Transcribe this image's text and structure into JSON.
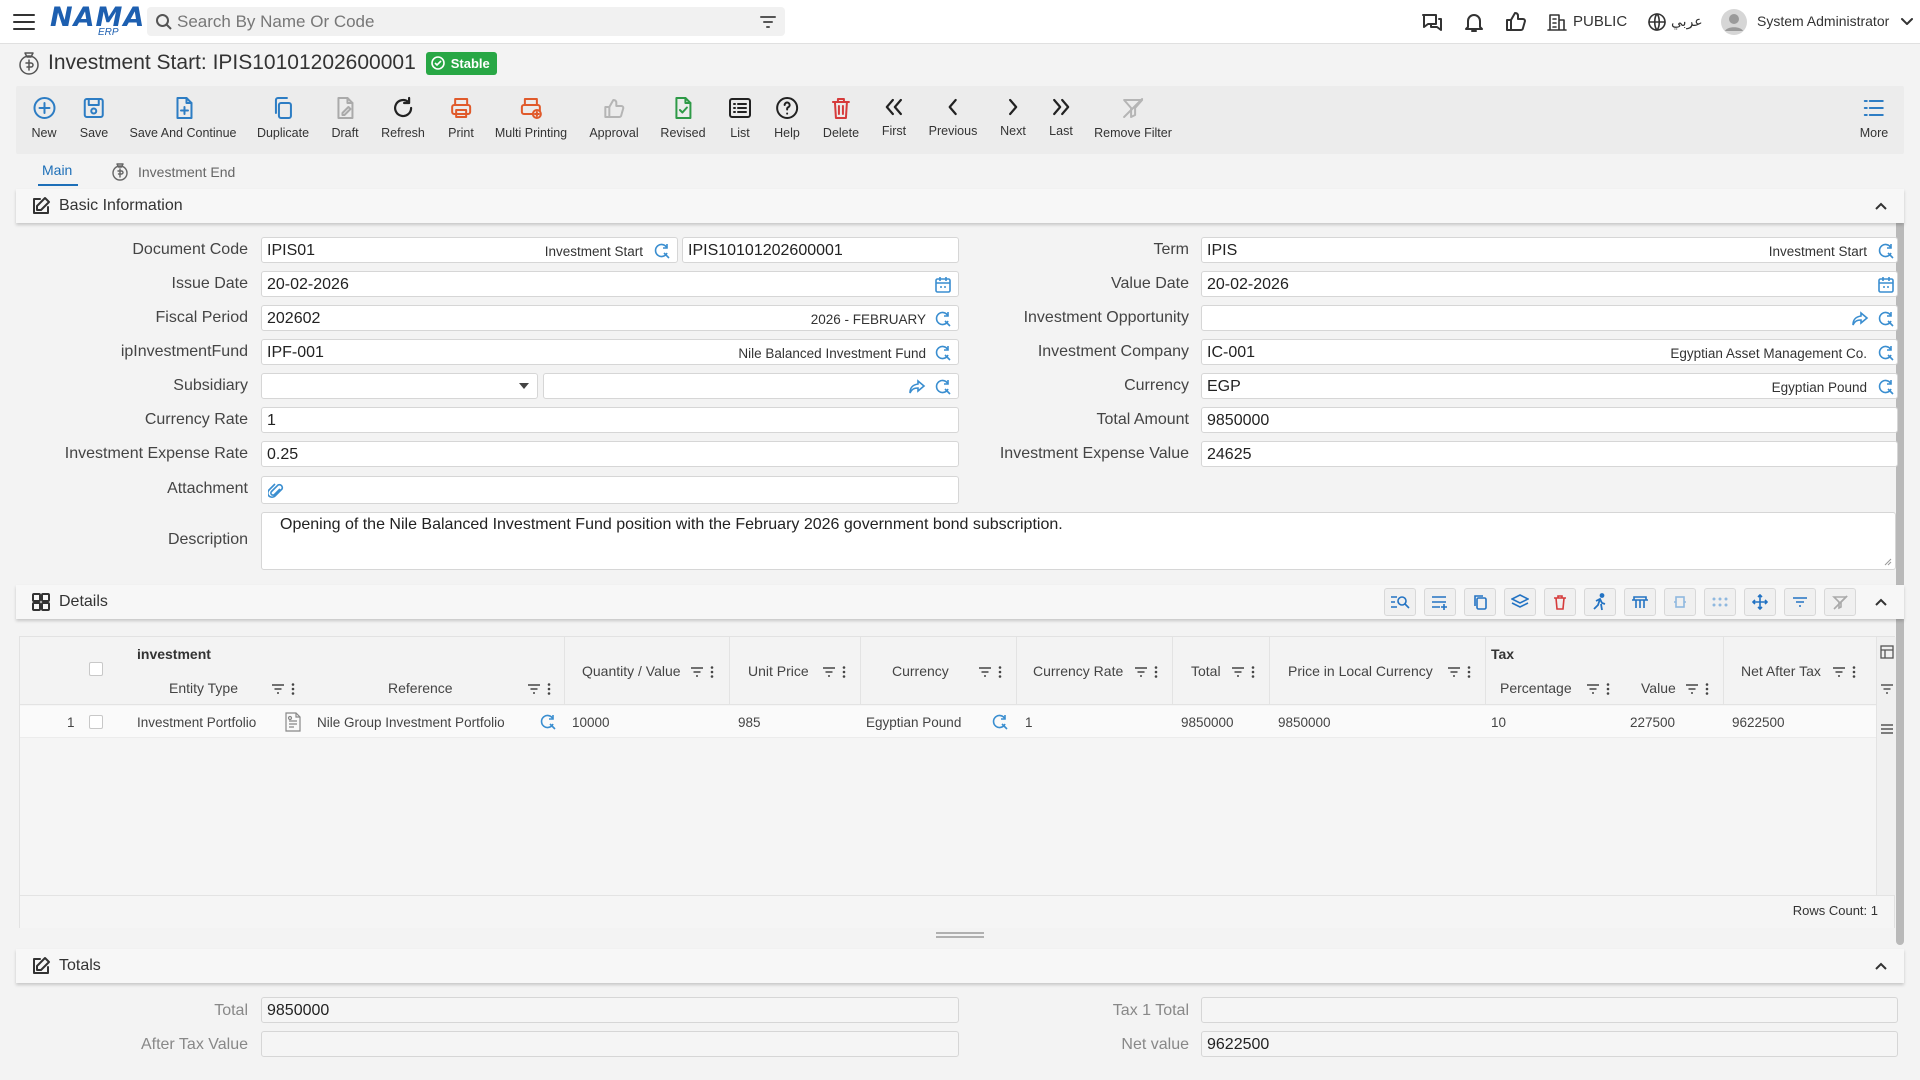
{
  "header": {
    "search_placeholder": "Search By Name Or Code",
    "logo": "NAMA",
    "logo_sub": "ERP",
    "visibility": "PUBLIC",
    "language": "عربي",
    "user": "System Administrator"
  },
  "title": {
    "text": "Investment Start: IPIS10101202600001",
    "status": "Stable"
  },
  "toolbar": {
    "new": "New",
    "save": "Save",
    "save_continue": "Save And Continue",
    "duplicate": "Duplicate",
    "draft": "Draft",
    "refresh": "Refresh",
    "print": "Print",
    "multi_printing": "Multi Printing",
    "approval": "Approval",
    "revised": "Revised",
    "list": "List",
    "help": "Help",
    "delete": "Delete",
    "first": "First",
    "previous": "Previous",
    "next": "Next",
    "last": "Last",
    "remove_filter": "Remove Filter",
    "more": "More"
  },
  "tabs": {
    "main": "Main",
    "investment_end": "Investment End"
  },
  "basic": {
    "title": "Basic Information",
    "document_code": {
      "label": "Document Code",
      "value": "IPIS01",
      "desc": "Investment Start",
      "code": "IPIS10101202600001"
    },
    "issue_date": {
      "label": "Issue Date",
      "value": "20-02-2026"
    },
    "fiscal_period": {
      "label": "Fiscal Period",
      "value": "202602",
      "desc": "2026 - FEBRUARY"
    },
    "fund": {
      "label": "ipInvestmentFund",
      "value": "IPF-001",
      "desc": "Nile Balanced Investment Fund"
    },
    "subsidiary": {
      "label": "Subsidiary",
      "value": "",
      "desc": ""
    },
    "currency_rate": {
      "label": "Currency Rate",
      "value": "1"
    },
    "expense_rate": {
      "label": "Investment Expense Rate",
      "value": "0.25"
    },
    "attachment": {
      "label": "Attachment"
    },
    "description": {
      "label": "Description",
      "value": "Opening of the Nile Balanced Investment Fund position with the February 2026 government bond subscription."
    },
    "term": {
      "label": "Term",
      "value": "IPIS",
      "desc": "Investment Start"
    },
    "value_date": {
      "label": "Value Date",
      "value": "20-02-2026"
    },
    "opportunity": {
      "label": "Investment Opportunity",
      "value": ""
    },
    "company": {
      "label": "Investment Company",
      "value": "IC-001",
      "desc": "Egyptian Asset Management Co."
    },
    "currency": {
      "label": "Currency",
      "value": "EGP",
      "desc": "Egyptian Pound"
    },
    "total_amount": {
      "label": "Total Amount",
      "value": "9850000"
    },
    "expense_value": {
      "label": "Investment Expense Value",
      "value": "24625"
    }
  },
  "details": {
    "title": "Details",
    "group_investment": "investment",
    "group_tax": "Tax",
    "columns": {
      "entity_type": "Entity Type",
      "reference": "Reference",
      "quantity": "Quantity / Value",
      "unit_price": "Unit Price",
      "currency": "Currency",
      "currency_rate": "Currency Rate",
      "total": "Total",
      "price_local": "Price in Local Currency",
      "percentage": "Percentage",
      "value": "Value",
      "net_after_tax": "Net After Tax"
    },
    "rows": [
      {
        "n": "1",
        "entity_type": "Investment Portfolio",
        "reference": "Nile Group Investment Portfolio",
        "quantity": "10000",
        "unit_price": "985",
        "currency": "Egyptian Pound",
        "currency_rate": "1",
        "total": "9850000",
        "price_local": "9850000",
        "percentage": "10",
        "value": "227500",
        "net_after_tax": "9622500"
      }
    ],
    "rows_count": "Rows Count: 1"
  },
  "totals": {
    "title": "Totals",
    "total": {
      "label": "Total",
      "value": "9850000"
    },
    "after_tax": {
      "label": "After Tax Value",
      "value": ""
    },
    "tax1_total": {
      "label": "Tax 1 Total",
      "value": ""
    },
    "net_value": {
      "label": "Net value",
      "value": "9622500"
    }
  }
}
